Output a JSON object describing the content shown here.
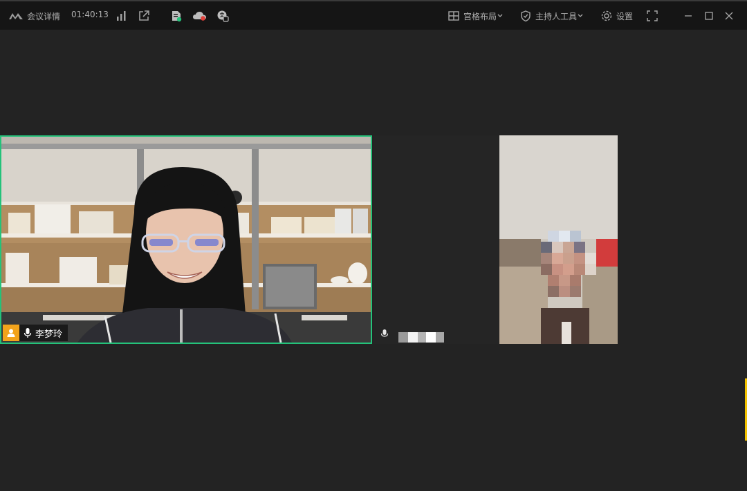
{
  "titlebar": {
    "meeting_details": "会议详情",
    "duration": "01:40:13",
    "layout_label": "宫格布局",
    "host_tools_label": "主持人工具",
    "settings_label": "设置"
  },
  "participants": {
    "active_speaker_name": "李梦玲"
  },
  "colors": {
    "active_border": "#24c27a",
    "host_badge": "#f2a31b",
    "background": "#232323",
    "titlebar": "#151515"
  },
  "icons": {
    "logo": "app-logo-icon",
    "signal": "signal-bars-icon",
    "share": "external-share-icon",
    "document": "document-icon",
    "cloud_record": "cloud-record-icon",
    "translate": "translate-icon",
    "grid": "grid-layout-icon",
    "shield": "shield-icon",
    "gear": "gear-icon",
    "fullscreen": "fullscreen-icon",
    "minimize": "minimize-icon",
    "maximize": "maximize-icon",
    "close": "close-icon",
    "host": "host-user-icon",
    "mic": "microphone-icon"
  }
}
